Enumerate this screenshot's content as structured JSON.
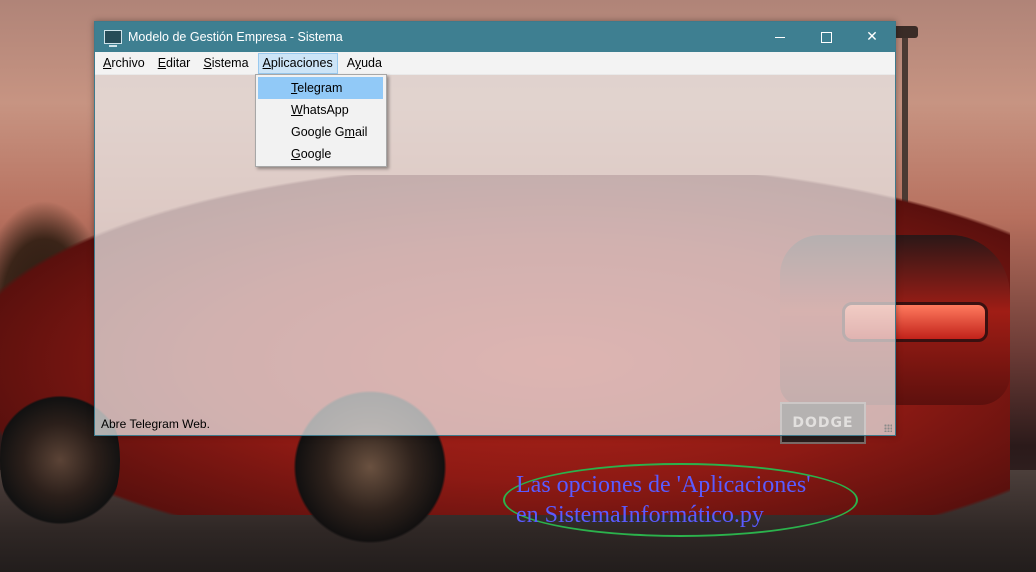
{
  "window": {
    "title": "Modelo de Gestión Empresa - Sistema",
    "controls": [
      "minimize",
      "maximize",
      "close"
    ]
  },
  "menubar": {
    "items": [
      {
        "label": "Archivo",
        "mnemonic": "A",
        "rest": "rchivo"
      },
      {
        "label": "Editar",
        "mnemonic": "E",
        "rest": "ditar"
      },
      {
        "label": "Sistema",
        "mnemonic": "S",
        "rest": "istema"
      },
      {
        "label": "Aplicaciones",
        "mnemonic": "A",
        "rest": "plicaciones",
        "active": true
      },
      {
        "label": "Ayuda",
        "pre": "A",
        "mnemonic": "y",
        "rest": "uda"
      }
    ]
  },
  "dropdown": {
    "items": [
      {
        "label": "Telegram",
        "pre": "",
        "mnemonic": "T",
        "rest": "elegram",
        "highlighted": true
      },
      {
        "label": "WhatsApp",
        "pre": "",
        "mnemonic": "W",
        "rest": "hatsApp"
      },
      {
        "label": "Google Gmail",
        "pre": "Google G",
        "mnemonic": "m",
        "rest": "ail"
      },
      {
        "label": "Google",
        "pre": "",
        "mnemonic": "G",
        "rest": "oogle"
      }
    ]
  },
  "statusbar": {
    "text": "Abre Telegram Web."
  },
  "annotation": {
    "line1": "Las opciones de 'Aplicaciones'",
    "line2": "en SistemaInformático.py"
  },
  "wallpaper": {
    "plate_text": "DODGE"
  },
  "colors": {
    "titlebar": "#3e7f91",
    "menu_highlight": "#91c9f7",
    "annotation_text": "#5a5bff",
    "annotation_border": "#2bb24c"
  }
}
